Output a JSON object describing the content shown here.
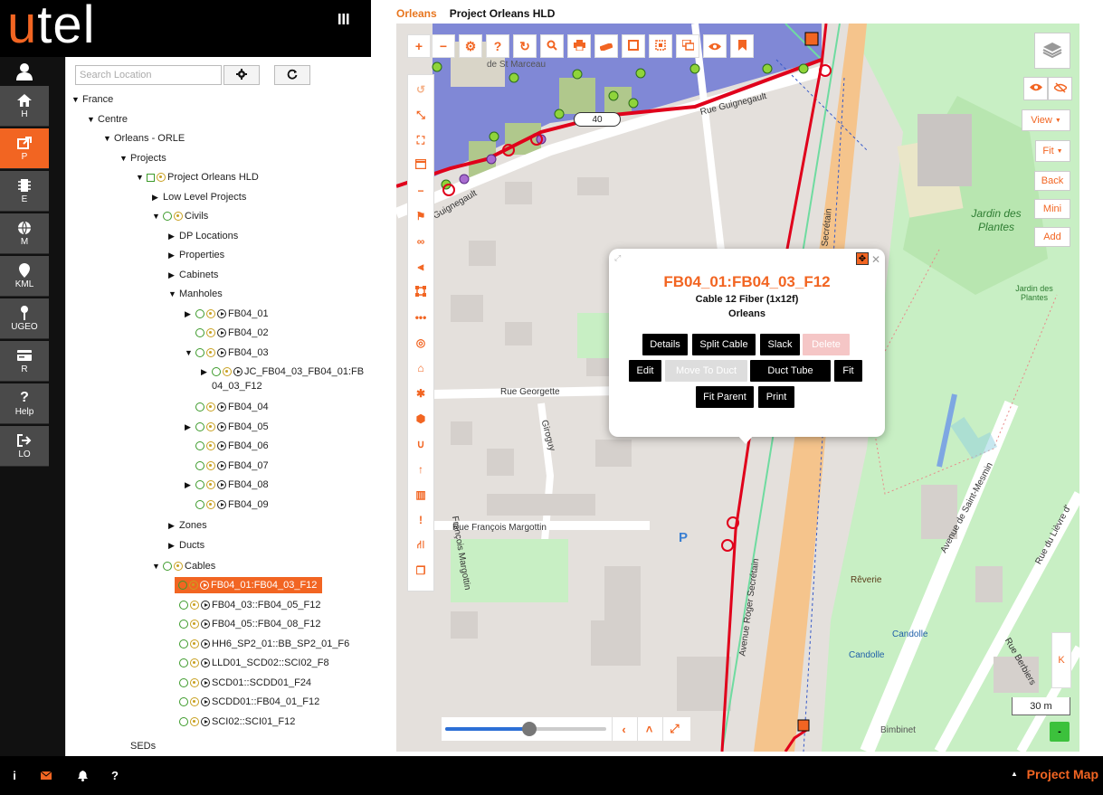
{
  "app": {
    "logo_u": "u",
    "logo_rest": "tel"
  },
  "nav": [
    {
      "label": "H",
      "icon": "home-icon"
    },
    {
      "label": "P",
      "icon": "share-icon"
    },
    {
      "label": "E",
      "icon": "chip-icon"
    },
    {
      "label": "M",
      "icon": "globe-icon"
    },
    {
      "label": "KML",
      "icon": "map-pin-icon"
    },
    {
      "label": "UGEO",
      "icon": "pin-icon"
    },
    {
      "label": "R",
      "icon": "card-icon"
    },
    {
      "label": "Help",
      "icon": "question-icon"
    },
    {
      "label": "LO",
      "icon": "logout-icon"
    }
  ],
  "search": {
    "placeholder": "Search Location"
  },
  "tree": {
    "france": "France",
    "centre": "Centre",
    "orleans": "Orleans - ORLE",
    "projects": "Projects",
    "project": "Project Orleans HLD",
    "low_level": "Low Level Projects",
    "civils": "Civils",
    "dp_locations": "DP Locations",
    "properties": "Properties",
    "cabinets": "Cabinets",
    "manholes": "Manholes",
    "fb01": "FB04_01",
    "fb02": "FB04_02",
    "fb03": "FB04_03",
    "jc_line1": "JC_FB04_03_FB04_01:FB",
    "jc_line2": "04_03_F12",
    "fb04": "FB04_04",
    "fb05": "FB04_05",
    "fb06": "FB04_06",
    "fb07": "FB04_07",
    "fb08": "FB04_08",
    "fb09": "FB04_09",
    "zones": "Zones",
    "ducts": "Ducts",
    "cables": "Cables",
    "cable_items": [
      "FB04_01:FB04_03_F12",
      "FB04_03::FB04_05_F12",
      "FB04_05::FB04_08_F12",
      "HH6_SP2_01::BB_SP2_01_F6",
      "LLD01_SCD02::SCI02_F8",
      "SCD01::SCDD01_F24",
      "SCDD01::FB04_01_F12",
      "SCI02::SCI01_F12"
    ],
    "seds": "SEDs"
  },
  "breadcrumb": {
    "first": "Orleans",
    "second": "Project Orleans HLD"
  },
  "map": {
    "badge": "40",
    "scale": "30 m",
    "k_label": "K",
    "minus": "-",
    "streets": {
      "guignegault": "Rue Guignegault",
      "guignegault2": "Guignegault",
      "marceau": "de St Marceau",
      "georgette": "Rue Georgette",
      "giroguy": "Giroguy",
      "margottin": "Rue François Margottin",
      "margottin2": "François Margottin",
      "secretain": "Avenue Roger Secrétain",
      "secretain2": "Secrétain",
      "saint_mesmin": "Avenue de Saint-Mesmin",
      "lievre": "Rue du Lièvre d'",
      "berbiers": "Rue Berbiers",
      "jardin": "Jardin des Plantes",
      "jardin_small": "Jardin des Plantes",
      "reverie": "Rêverie",
      "candolle": "Candolle",
      "candolle2": "Candolle",
      "bimbinet": "Bimbinet",
      "p": "P"
    }
  },
  "controls": {
    "view": "View",
    "fit": "Fit",
    "back": "Back",
    "mini": "Mini",
    "add": "Add"
  },
  "popup": {
    "title": "FB04_01:FB04_03_F12",
    "subtitle": "Cable 12 Fiber (1x12f)",
    "location": "Orleans",
    "buttons": {
      "details": "Details",
      "split_cable": "Split Cable",
      "slack": "Slack",
      "delete": "Delete",
      "edit": "Edit",
      "move_to_duct": "Move To Duct",
      "duct_tube": "Duct Tube",
      "fit": "Fit",
      "fit_parent": "Fit Parent",
      "print": "Print"
    }
  },
  "slider": {
    "value": 0.52
  },
  "bottom": {
    "project_map": "Project Map"
  },
  "colors": {
    "accent": "#f26522",
    "nav_bg": "#4a4a4a",
    "cable_red": "#e0001b"
  }
}
